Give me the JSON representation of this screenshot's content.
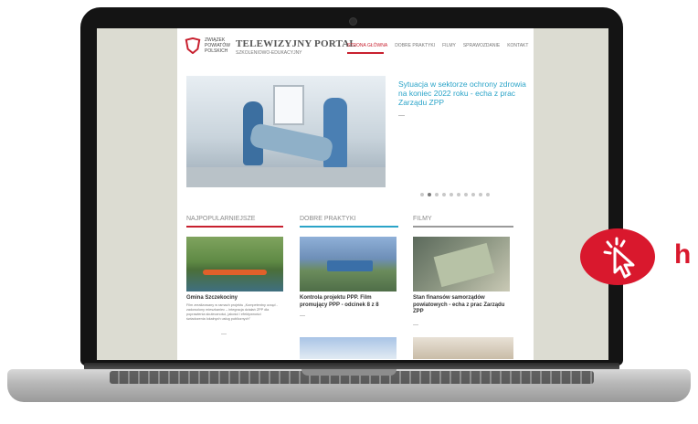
{
  "site": {
    "logo_lines": [
      "ZWIĄZEK",
      "POWIATÓW",
      "POLSKICH"
    ],
    "title": "TELEWIZYJNY PORTAL",
    "subtitle": "SZKOLENIOWO-EDUKACYJNY"
  },
  "nav": {
    "items": [
      "STRONA GŁÓWNA",
      "DOBRE PRAKTYKI",
      "FILMY",
      "SPRAWOZDANIE",
      "KONTAKT"
    ],
    "active_index": 0
  },
  "hero": {
    "caption": "Sytuacja w sektorze ochrony zdrowia na koniec 2022 roku - echa z prac Zarządu ZPP",
    "more": "—",
    "slide_count": 10,
    "active_slide": 1
  },
  "sections": [
    {
      "title": "NAJPOPULARNIEJSZE",
      "accent": "#c8202f"
    },
    {
      "title": "DOBRE PRAKTYKI",
      "accent": "#2ba4c8"
    },
    {
      "title": "FILMY",
      "accent": "#9a9a9a"
    }
  ],
  "cards": [
    {
      "title": "Gmina Szczekociny",
      "text": "Film zrealizowany w ramach projektu „Kompetentny urząd - zadowolony mieszkaniec – integracja działań ZPP dla poprawienia skuteczności, jakości i efektywności świadczenia lokalnych usług publicznych”",
      "more": "—"
    },
    {
      "title": "Kontrola projektu PPP. Film promujący PPP - odcinek 8 z 8",
      "text": "",
      "more": "—"
    },
    {
      "title": "Stan finansów samorządów powiatowych - echa z prac Zarządu ZPP",
      "text": "",
      "more": "—"
    }
  ],
  "badge": {
    "icon": "cursor-click-icon",
    "letter": "h",
    "color": "#d9182d"
  }
}
